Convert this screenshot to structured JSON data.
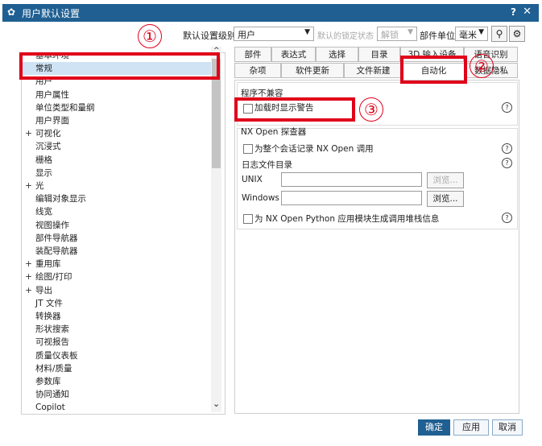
{
  "window": {
    "title": "用户默认设置",
    "help": "?",
    "close": "✕"
  },
  "toolbar": {
    "level_label": "默认设置级别",
    "level_value": "用户",
    "lock_label": "默认的锁定状态",
    "lock_value": "解锁",
    "unit_label": "部件单位",
    "unit_value": "毫米"
  },
  "tree": {
    "items": [
      {
        "label": "基本环境",
        "expander": ""
      },
      {
        "label": "常规",
        "expander": ""
      },
      {
        "label": "用户",
        "expander": ""
      },
      {
        "label": "用户属性",
        "expander": ""
      },
      {
        "label": "单位类型和量纲",
        "expander": ""
      },
      {
        "label": "用户界面",
        "expander": ""
      },
      {
        "label": "可视化",
        "expander": "+"
      },
      {
        "label": "沉浸式",
        "expander": ""
      },
      {
        "label": "栅格",
        "expander": ""
      },
      {
        "label": "显示",
        "expander": ""
      },
      {
        "label": "光",
        "expander": "+"
      },
      {
        "label": "编辑对象显示",
        "expander": ""
      },
      {
        "label": "线宽",
        "expander": ""
      },
      {
        "label": "视图操作",
        "expander": ""
      },
      {
        "label": "部件导航器",
        "expander": ""
      },
      {
        "label": "装配导航器",
        "expander": ""
      },
      {
        "label": "重用库",
        "expander": "+"
      },
      {
        "label": "绘图/打印",
        "expander": "+"
      },
      {
        "label": "导出",
        "expander": "+"
      },
      {
        "label": "JT 文件",
        "expander": ""
      },
      {
        "label": "转换器",
        "expander": ""
      },
      {
        "label": "形状搜索",
        "expander": ""
      },
      {
        "label": "可视报告",
        "expander": ""
      },
      {
        "label": "质量仪表板",
        "expander": ""
      },
      {
        "label": "材料/质量",
        "expander": ""
      },
      {
        "label": "参数库",
        "expander": ""
      },
      {
        "label": "协同通知",
        "expander": ""
      },
      {
        "label": "Copilot",
        "expander": ""
      }
    ],
    "scroll_up": "^",
    "scroll_down": "⌄"
  },
  "tabs": {
    "row1": [
      "部件",
      "表达式",
      "选择",
      "目录",
      "3D 输入设备",
      "语音识别"
    ],
    "row2": [
      "杂项",
      "软件更新",
      "文件新建",
      "自动化",
      "数据隐私"
    ],
    "active": "自动化"
  },
  "content": {
    "group1_title": "程序不兼容",
    "load_warning_label": "加载时显示警告",
    "group2_title": "NX Open 探查器",
    "record_label": "为整个会话记录 NX Open 调用",
    "log_dir_label": "日志文件目录",
    "unix_label": "UNIX",
    "unix_value": "",
    "windows_label": "Windows",
    "windows_value": "",
    "browse_label": "浏览...",
    "stack_label": "为 NX Open Python 应用模块生成调用堆栈信息",
    "help_glyph": "?"
  },
  "annotations": {
    "one": "①",
    "two": "②",
    "three": "③"
  },
  "footer": {
    "ok": "确定",
    "apply": "应用",
    "cancel": "取消"
  },
  "colors": {
    "titlebar": "#1f5f92",
    "highlight": "#e0001a",
    "selected": "#cfe3f5"
  }
}
